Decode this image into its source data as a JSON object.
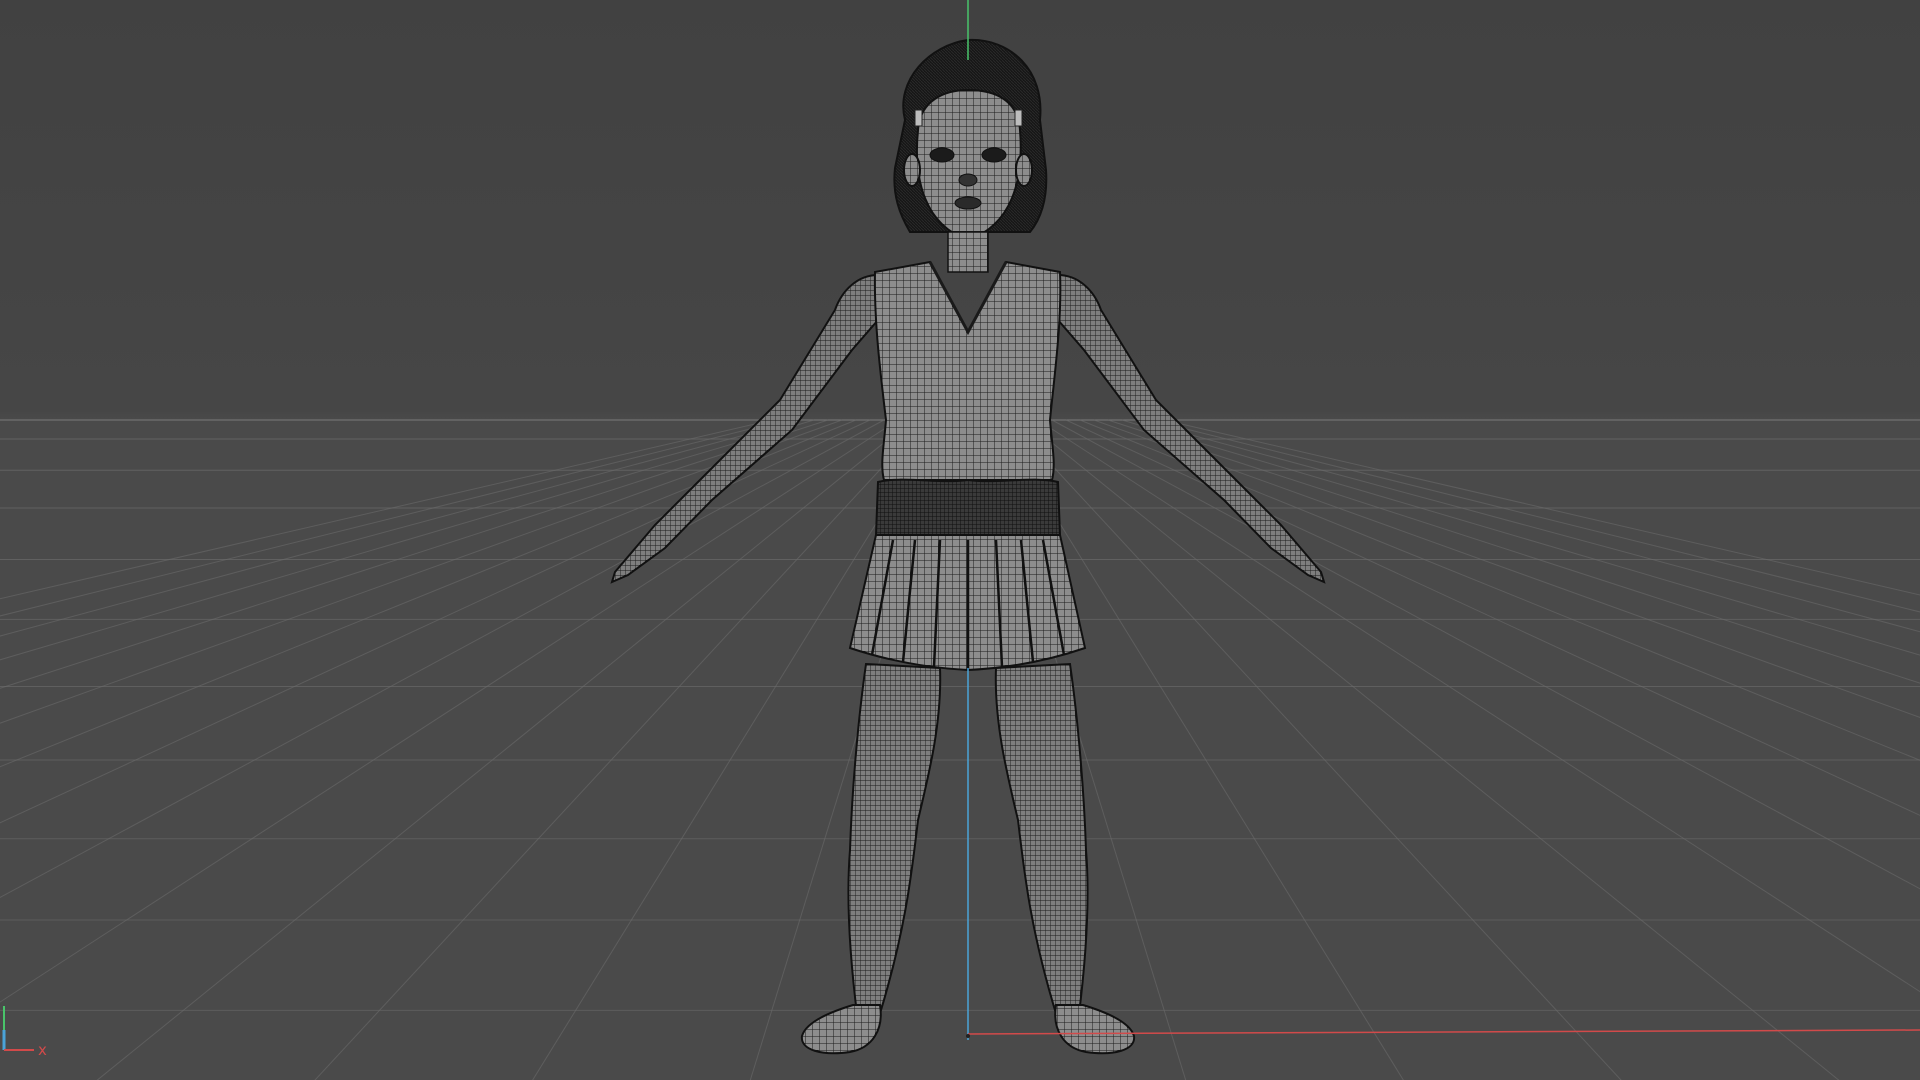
{
  "viewport": {
    "view_mode": "wireframe",
    "background": "#464646",
    "grid_color": "#6a6a6a",
    "model_fill": "#8a8a8a",
    "wire_color": "#1a1a1a",
    "hair_color": "#141414"
  },
  "axes": {
    "x_label": "x",
    "x_color": "#d24a4a",
    "y_color": "#49c46a",
    "z_color": "#4aa3d8"
  }
}
